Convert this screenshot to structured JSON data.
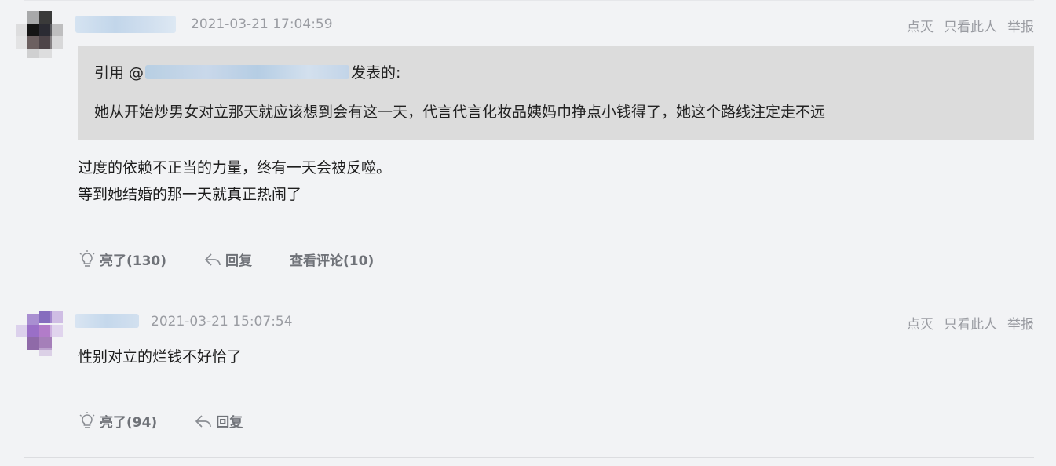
{
  "comments": [
    {
      "timestamp": "2021-03-21 17:04:59",
      "actions": [
        "点灭",
        "只看此人",
        "举报"
      ],
      "quote": {
        "prefix": "引用 @",
        "suffix": "发表的:",
        "text": "她从开始炒男女对立那天就应该想到会有这一天，代言代言化妆品姨妈巾挣点小钱得了，她这个路线注定走不远"
      },
      "lines": [
        "过度的依赖不正当的力量，终有一天会被反噬。",
        "等到她结婚的那一天就真正热闹了"
      ],
      "like_label": "亮了(130)",
      "reply_label": "回复",
      "view_comments_label": "查看评论(10)"
    },
    {
      "timestamp": "2021-03-21 15:07:54",
      "actions": [
        "点灭",
        "只看此人",
        "举报"
      ],
      "lines": [
        "性别对立的烂钱不好恰了"
      ],
      "like_label": "亮了(94)",
      "reply_label": "回复"
    }
  ],
  "icons": {
    "like": "lightbulb-icon",
    "reply": "reply-arrow-icon"
  },
  "colors": {
    "background": "#f2f3f5",
    "quote_bg": "#dcdcdc",
    "muted": "#9a9ca2",
    "footer": "#6f7278"
  }
}
